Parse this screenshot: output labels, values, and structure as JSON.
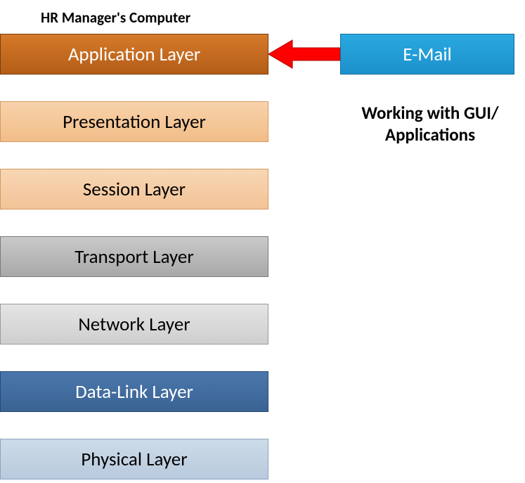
{
  "title": "HR Manager's Computer",
  "layers": {
    "application": "Application Layer",
    "presentation": "Presentation Layer",
    "session": "Session Layer",
    "transport": "Transport Layer",
    "network": "Network Layer",
    "datalink": "Data-Link Layer",
    "physical": "Physical Layer"
  },
  "right": {
    "email": "E-Mail",
    "caption": "Working with GUI/ Applications"
  },
  "colors": {
    "application": "#c06a1f",
    "presentation_session": "#f3c397",
    "transport": "#b8b8b8",
    "network": "#d9d9d9",
    "datalink": "#3f6da0",
    "physical": "#c3d3e3",
    "email": "#22a0d8",
    "arrow": "#ff0000"
  },
  "diagram_data": {
    "type": "osi-layer-stack",
    "description": "Seven OSI model layers on the left; E-Mail box on the right with a red arrow pointing into the Application Layer. Caption indicates working at the GUI/application level.",
    "nodes": [
      {
        "id": "application",
        "label": "Application Layer",
        "row": 1
      },
      {
        "id": "presentation",
        "label": "Presentation Layer",
        "row": 2
      },
      {
        "id": "session",
        "label": "Session Layer",
        "row": 3
      },
      {
        "id": "transport",
        "label": "Transport Layer",
        "row": 4
      },
      {
        "id": "network",
        "label": "Network Layer",
        "row": 5
      },
      {
        "id": "datalink",
        "label": "Data-Link Layer",
        "row": 6
      },
      {
        "id": "physical",
        "label": "Physical Layer",
        "row": 7
      },
      {
        "id": "email",
        "label": "E-Mail",
        "row": 1,
        "side": "right"
      }
    ],
    "edges": [
      {
        "from": "email",
        "to": "application",
        "direction": "left",
        "color": "#ff0000"
      }
    ],
    "caption": "Working with GUI/ Applications"
  }
}
